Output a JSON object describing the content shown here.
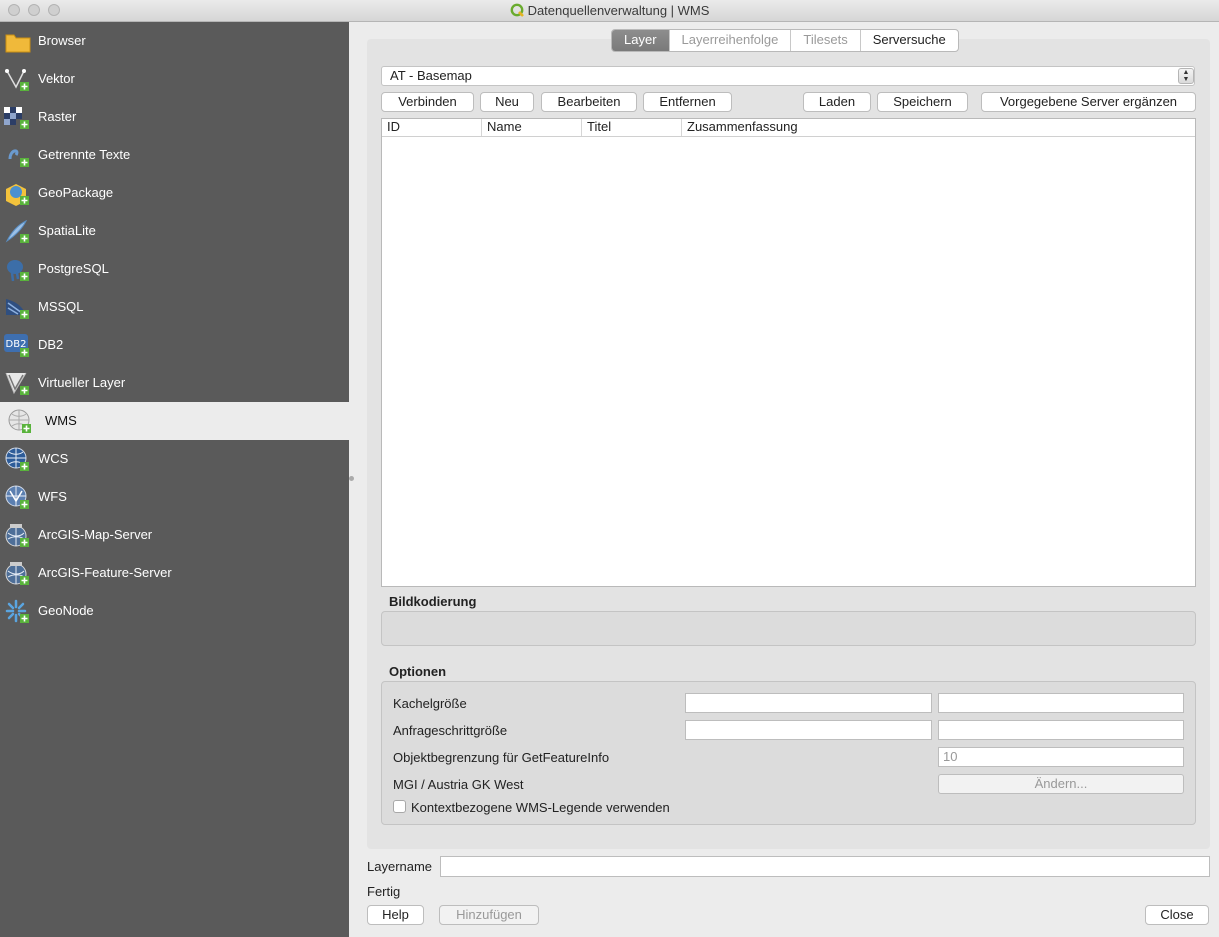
{
  "window": {
    "title": "Datenquellenverwaltung | WMS"
  },
  "sidebar": {
    "items": [
      {
        "label": "Browser",
        "icon": "folder-icon"
      },
      {
        "label": "Vektor",
        "icon": "vector-icon"
      },
      {
        "label": "Raster",
        "icon": "raster-icon"
      },
      {
        "label": "Getrennte Texte",
        "icon": "delimited-text-icon"
      },
      {
        "label": "GeoPackage",
        "icon": "geopackage-icon"
      },
      {
        "label": "SpatiaLite",
        "icon": "spatialite-icon"
      },
      {
        "label": "PostgreSQL",
        "icon": "postgresql-icon"
      },
      {
        "label": "MSSQL",
        "icon": "mssql-icon"
      },
      {
        "label": "DB2",
        "icon": "db2-icon"
      },
      {
        "label": "Virtueller Layer",
        "icon": "virtual-layer-icon"
      },
      {
        "label": "WMS",
        "icon": "wms-globe-icon",
        "selected": true
      },
      {
        "label": "WCS",
        "icon": "wcs-globe-icon"
      },
      {
        "label": "WFS",
        "icon": "wfs-globe-icon"
      },
      {
        "label": "ArcGIS-Map-Server",
        "icon": "arcgis-map-icon"
      },
      {
        "label": "ArcGIS-Feature-Server",
        "icon": "arcgis-feature-icon"
      },
      {
        "label": "GeoNode",
        "icon": "geonode-icon"
      }
    ]
  },
  "tabs": [
    {
      "label": "Layer",
      "active": true
    },
    {
      "label": "Layerreihenfolge",
      "enabled": false
    },
    {
      "label": "Tilesets",
      "enabled": false
    },
    {
      "label": "Serversuche"
    }
  ],
  "connection": {
    "selected": "AT - Basemap",
    "buttons": {
      "connect": "Verbinden",
      "new": "Neu",
      "edit": "Bearbeiten",
      "remove": "Entfernen",
      "load": "Laden",
      "save": "Speichern",
      "add_default": "Vorgegebene Server ergänzen"
    }
  },
  "layer_table": {
    "columns": [
      "ID",
      "Name",
      "Titel",
      "Zusammenfassung"
    ],
    "rows": []
  },
  "image_encoding": {
    "title": "Bildkodierung"
  },
  "options": {
    "title": "Optionen",
    "tile_size_label": "Kachelgröße",
    "request_step_label": "Anfrageschrittgröße",
    "feature_limit_label": "Objektbegrenzung für GetFeatureInfo",
    "feature_limit_placeholder": "10",
    "crs_label": "MGI / Austria GK West",
    "change_button": "Ändern...",
    "legend_checkbox": "Kontextbezogene WMS-Legende verwenden",
    "legend_checked": false
  },
  "layername": {
    "label": "Layername",
    "value": ""
  },
  "status": "Fertig",
  "footer": {
    "help": "Help",
    "add": "Hinzufügen",
    "close": "Close"
  },
  "colors": {
    "sidebar_bg": "#5a5a5a",
    "selected_bg": "#ececec",
    "tab_active": "#808080"
  }
}
